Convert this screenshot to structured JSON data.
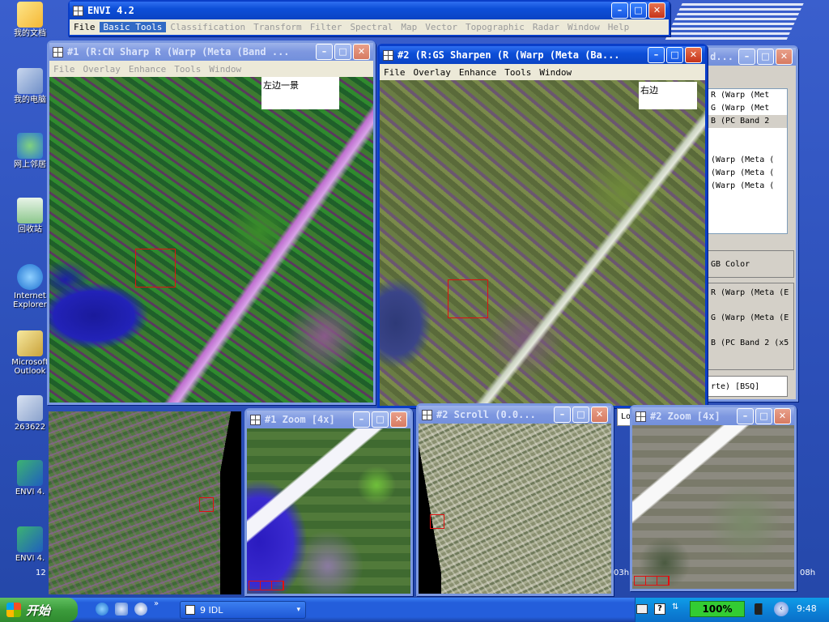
{
  "desktop": {
    "icons": [
      {
        "label": "我的文档"
      },
      {
        "label": "我的电脑"
      },
      {
        "label": "网上邻居"
      },
      {
        "label": "回收站"
      },
      {
        "label": "Internet Explorer"
      },
      {
        "label": "Microsoft Outlook"
      },
      {
        "label": "263622"
      },
      {
        "label": "ENVI 4."
      },
      {
        "label": "ENVI 4."
      }
    ],
    "ibm_logo": "IBM"
  },
  "envi_main": {
    "title": "ENVI 4.2",
    "menu": [
      "File",
      "Basic Tools",
      "Classification",
      "Transform",
      "Filter",
      "Spectral",
      "Map",
      "Vector",
      "Topographic",
      "Radar",
      "Window",
      "Help"
    ]
  },
  "display1": {
    "title": "#1 (R:CN Sharp R (Warp (Meta (Band ...",
    "menu": [
      "File",
      "Overlay",
      "Enhance",
      "Tools",
      "Window"
    ],
    "note": "左边一景"
  },
  "display2": {
    "title": "#2 (R:GS Sharpen (R (Warp (Meta (Ba...",
    "menu": [
      "File",
      "Overlay",
      "Enhance",
      "Tools",
      "Window"
    ],
    "note": "右边"
  },
  "band_list": {
    "title_fragment": "d...",
    "rows": [
      "R (Warp (Met",
      "G (Warp (Met",
      "B (PC Band 2",
      "",
      "(Warp (Meta (",
      "(Warp (Meta (",
      "(Warp (Meta ("
    ],
    "mode": "GB Color",
    "rgb_rows": [
      "R (Warp (Meta (E",
      "G (Warp (Meta (E",
      "B (PC Band 2 (x5"
    ],
    "dims": "rte) [BSQ]",
    "load_label": "Lo"
  },
  "zoom1": {
    "title": "#1 Zoom [4x]"
  },
  "scroll2": {
    "title": "#2 Scroll (0.0..."
  },
  "zoom2": {
    "title": "#2 Zoom [4x]"
  },
  "scroll_labels": {
    "left": "12",
    "mid": "03h",
    "right": "08h"
  },
  "taskbar": {
    "start": "开始",
    "task_item": "9 IDL",
    "zoom_indicator": "100%",
    "clock": "9:48"
  }
}
